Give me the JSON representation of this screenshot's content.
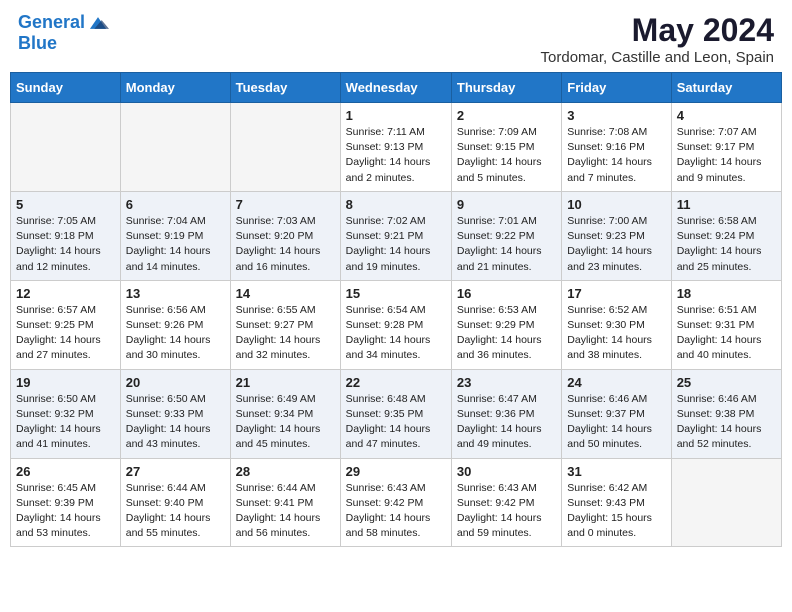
{
  "header": {
    "logo_line1": "General",
    "logo_line2": "Blue",
    "month": "May 2024",
    "location": "Tordomar, Castille and Leon, Spain"
  },
  "weekdays": [
    "Sunday",
    "Monday",
    "Tuesday",
    "Wednesday",
    "Thursday",
    "Friday",
    "Saturday"
  ],
  "weeks": [
    [
      {
        "day": "",
        "info": ""
      },
      {
        "day": "",
        "info": ""
      },
      {
        "day": "",
        "info": ""
      },
      {
        "day": "1",
        "info": "Sunrise: 7:11 AM\nSunset: 9:13 PM\nDaylight: 14 hours\nand 2 minutes."
      },
      {
        "day": "2",
        "info": "Sunrise: 7:09 AM\nSunset: 9:15 PM\nDaylight: 14 hours\nand 5 minutes."
      },
      {
        "day": "3",
        "info": "Sunrise: 7:08 AM\nSunset: 9:16 PM\nDaylight: 14 hours\nand 7 minutes."
      },
      {
        "day": "4",
        "info": "Sunrise: 7:07 AM\nSunset: 9:17 PM\nDaylight: 14 hours\nand 9 minutes."
      }
    ],
    [
      {
        "day": "5",
        "info": "Sunrise: 7:05 AM\nSunset: 9:18 PM\nDaylight: 14 hours\nand 12 minutes."
      },
      {
        "day": "6",
        "info": "Sunrise: 7:04 AM\nSunset: 9:19 PM\nDaylight: 14 hours\nand 14 minutes."
      },
      {
        "day": "7",
        "info": "Sunrise: 7:03 AM\nSunset: 9:20 PM\nDaylight: 14 hours\nand 16 minutes."
      },
      {
        "day": "8",
        "info": "Sunrise: 7:02 AM\nSunset: 9:21 PM\nDaylight: 14 hours\nand 19 minutes."
      },
      {
        "day": "9",
        "info": "Sunrise: 7:01 AM\nSunset: 9:22 PM\nDaylight: 14 hours\nand 21 minutes."
      },
      {
        "day": "10",
        "info": "Sunrise: 7:00 AM\nSunset: 9:23 PM\nDaylight: 14 hours\nand 23 minutes."
      },
      {
        "day": "11",
        "info": "Sunrise: 6:58 AM\nSunset: 9:24 PM\nDaylight: 14 hours\nand 25 minutes."
      }
    ],
    [
      {
        "day": "12",
        "info": "Sunrise: 6:57 AM\nSunset: 9:25 PM\nDaylight: 14 hours\nand 27 minutes."
      },
      {
        "day": "13",
        "info": "Sunrise: 6:56 AM\nSunset: 9:26 PM\nDaylight: 14 hours\nand 30 minutes."
      },
      {
        "day": "14",
        "info": "Sunrise: 6:55 AM\nSunset: 9:27 PM\nDaylight: 14 hours\nand 32 minutes."
      },
      {
        "day": "15",
        "info": "Sunrise: 6:54 AM\nSunset: 9:28 PM\nDaylight: 14 hours\nand 34 minutes."
      },
      {
        "day": "16",
        "info": "Sunrise: 6:53 AM\nSunset: 9:29 PM\nDaylight: 14 hours\nand 36 minutes."
      },
      {
        "day": "17",
        "info": "Sunrise: 6:52 AM\nSunset: 9:30 PM\nDaylight: 14 hours\nand 38 minutes."
      },
      {
        "day": "18",
        "info": "Sunrise: 6:51 AM\nSunset: 9:31 PM\nDaylight: 14 hours\nand 40 minutes."
      }
    ],
    [
      {
        "day": "19",
        "info": "Sunrise: 6:50 AM\nSunset: 9:32 PM\nDaylight: 14 hours\nand 41 minutes."
      },
      {
        "day": "20",
        "info": "Sunrise: 6:50 AM\nSunset: 9:33 PM\nDaylight: 14 hours\nand 43 minutes."
      },
      {
        "day": "21",
        "info": "Sunrise: 6:49 AM\nSunset: 9:34 PM\nDaylight: 14 hours\nand 45 minutes."
      },
      {
        "day": "22",
        "info": "Sunrise: 6:48 AM\nSunset: 9:35 PM\nDaylight: 14 hours\nand 47 minutes."
      },
      {
        "day": "23",
        "info": "Sunrise: 6:47 AM\nSunset: 9:36 PM\nDaylight: 14 hours\nand 49 minutes."
      },
      {
        "day": "24",
        "info": "Sunrise: 6:46 AM\nSunset: 9:37 PM\nDaylight: 14 hours\nand 50 minutes."
      },
      {
        "day": "25",
        "info": "Sunrise: 6:46 AM\nSunset: 9:38 PM\nDaylight: 14 hours\nand 52 minutes."
      }
    ],
    [
      {
        "day": "26",
        "info": "Sunrise: 6:45 AM\nSunset: 9:39 PM\nDaylight: 14 hours\nand 53 minutes."
      },
      {
        "day": "27",
        "info": "Sunrise: 6:44 AM\nSunset: 9:40 PM\nDaylight: 14 hours\nand 55 minutes."
      },
      {
        "day": "28",
        "info": "Sunrise: 6:44 AM\nSunset: 9:41 PM\nDaylight: 14 hours\nand 56 minutes."
      },
      {
        "day": "29",
        "info": "Sunrise: 6:43 AM\nSunset: 9:42 PM\nDaylight: 14 hours\nand 58 minutes."
      },
      {
        "day": "30",
        "info": "Sunrise: 6:43 AM\nSunset: 9:42 PM\nDaylight: 14 hours\nand 59 minutes."
      },
      {
        "day": "31",
        "info": "Sunrise: 6:42 AM\nSunset: 9:43 PM\nDaylight: 15 hours\nand 0 minutes."
      },
      {
        "day": "",
        "info": ""
      }
    ]
  ]
}
